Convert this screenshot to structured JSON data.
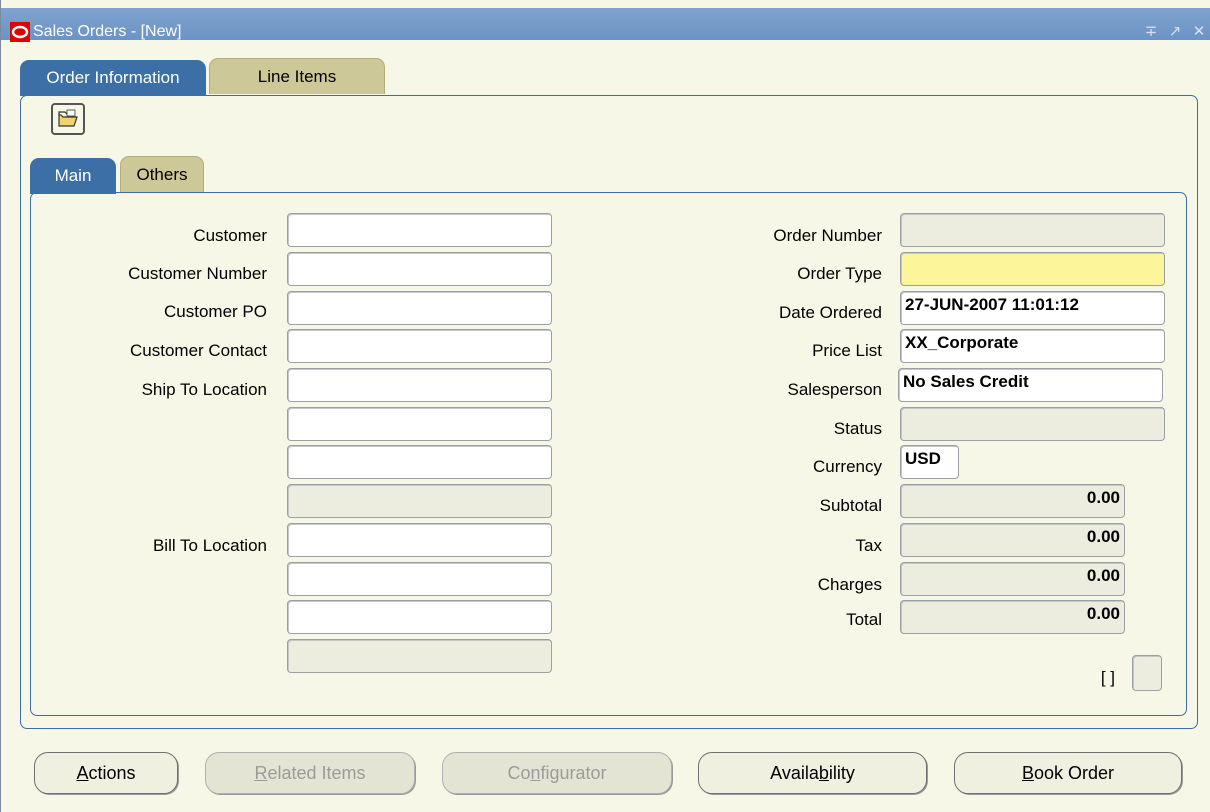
{
  "window": {
    "title": "Sales Orders - [New]"
  },
  "tabs": {
    "order_information": "Order Information",
    "line_items": "Line Items"
  },
  "subtabs": {
    "main": "Main",
    "others": "Others"
  },
  "left_fields": {
    "customer": {
      "label": "Customer",
      "value": ""
    },
    "customer_number": {
      "label": "Customer Number",
      "value": ""
    },
    "customer_po": {
      "label": "Customer PO",
      "value": ""
    },
    "customer_contact": {
      "label": "Customer Contact",
      "value": ""
    },
    "ship_to_location": {
      "label": "Ship To Location",
      "lines": [
        "",
        "",
        "",
        ""
      ]
    },
    "bill_to_location": {
      "label": "Bill To Location",
      "lines": [
        "",
        "",
        "",
        ""
      ]
    }
  },
  "right_fields": {
    "order_number": {
      "label": "Order Number",
      "value": ""
    },
    "order_type": {
      "label": "Order Type",
      "value": ""
    },
    "date_ordered": {
      "label": "Date Ordered",
      "value": "27-JUN-2007 11:01:12"
    },
    "price_list": {
      "label": "Price List",
      "value": "XX_Corporate"
    },
    "salesperson": {
      "label": "Salesperson",
      "value": "No Sales Credit"
    },
    "status": {
      "label": "Status",
      "value": ""
    },
    "currency": {
      "label": "Currency",
      "value": "USD"
    },
    "subtotal": {
      "label": "Subtotal",
      "value": "0.00"
    },
    "tax": {
      "label": "Tax",
      "value": "0.00"
    },
    "charges": {
      "label": "Charges",
      "value": "0.00"
    },
    "total": {
      "label": "Total",
      "value": "0.00"
    }
  },
  "flex_field": {
    "label": "[ ]"
  },
  "buttons": {
    "actions": {
      "prefix": "A",
      "rest": "ctions"
    },
    "related_items": {
      "prefix": "R",
      "rest": "elated Items"
    },
    "configurator": {
      "pre": "Co",
      "u": "n",
      "post": "figurator"
    },
    "availability": {
      "pre": "Availa",
      "u": "b",
      "post": "ility"
    },
    "book_order": {
      "prefix": "B",
      "rest": "ook Order"
    }
  },
  "colors": {
    "accent": "#3b6fa5",
    "required_field": "#fdf59a",
    "canvas": "#f7f7e7"
  }
}
